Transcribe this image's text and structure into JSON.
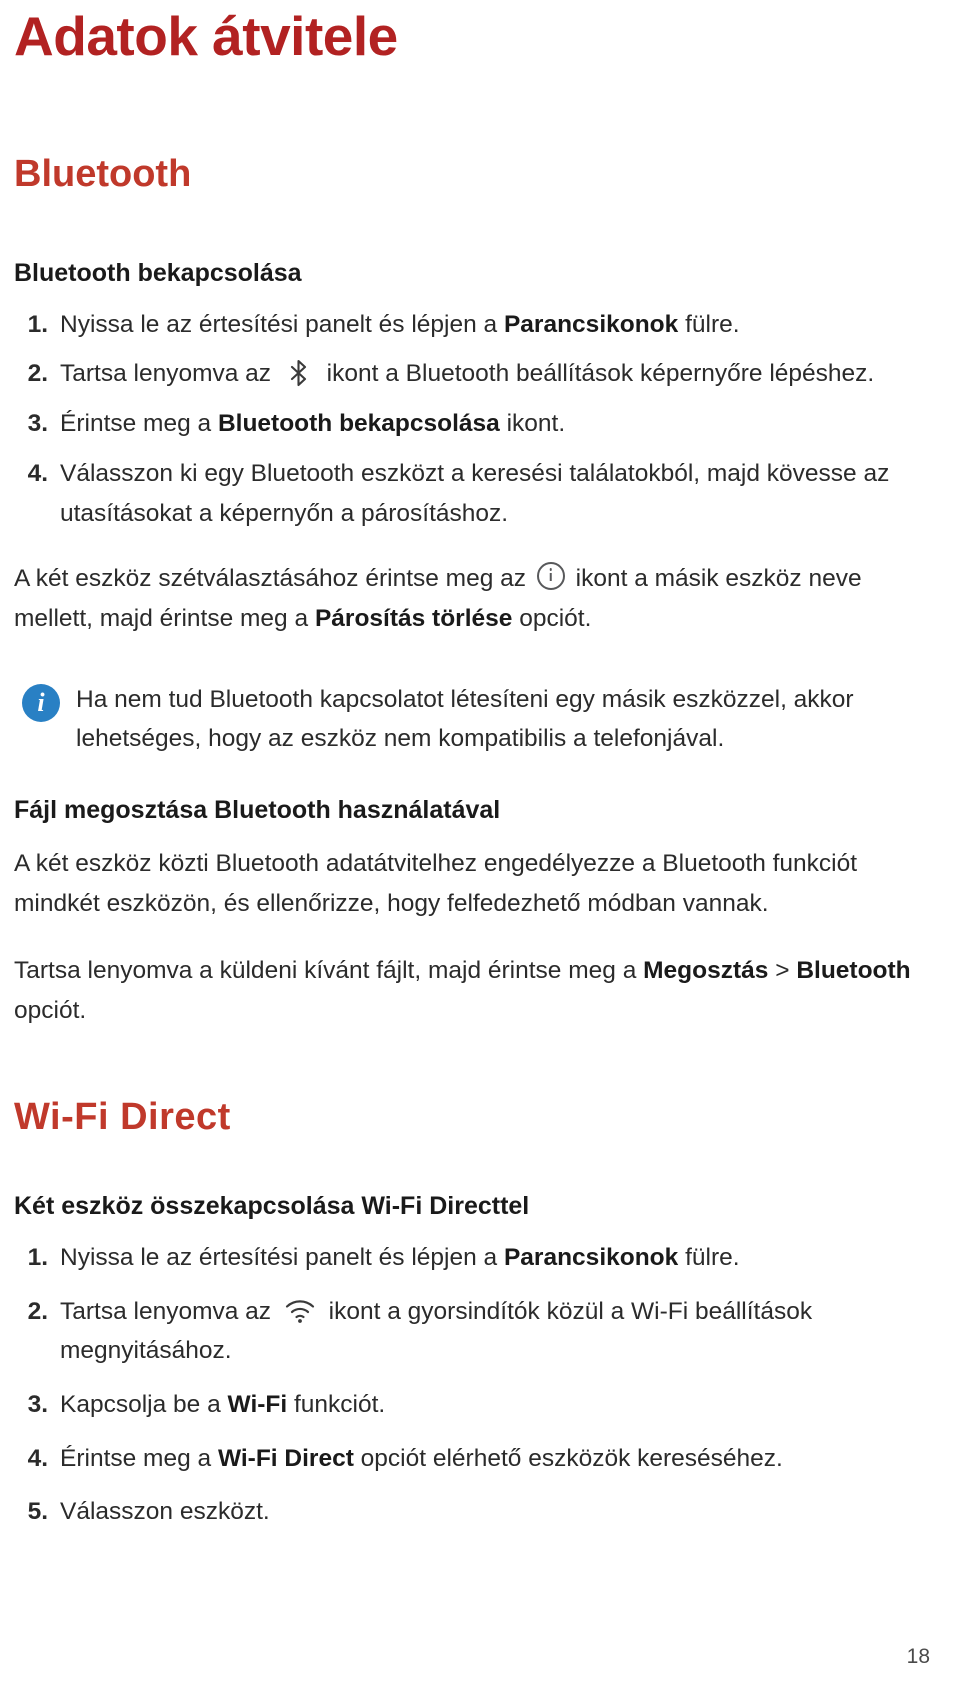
{
  "document": {
    "title": "Adatok átvitele",
    "page_number": "18"
  },
  "sections": [
    {
      "heading": "Bluetooth",
      "subsections": [
        {
          "heading": "Bluetooth bekapcsolása",
          "steps": [
            {
              "num": "1.",
              "text_before": "Nyissa le az értesítési panelt és lépjen a ",
              "bold": "Parancsikonok",
              "text_after": " fülre."
            },
            {
              "num": "2.",
              "text_before": "Tartsa lenyomva az ",
              "icon": "bluetooth-icon",
              "text_after": " ikont a Bluetooth beállítások képernyőre lépéshez."
            },
            {
              "num": "3.",
              "text_before": "Érintse meg a ",
              "bold": "Bluetooth bekapcsolása",
              "text_after": " ikont."
            },
            {
              "num": "4.",
              "text_before": "Válasszon ki egy Bluetooth eszközt a keresési találatokból, majd kövesse az utasításokat a képernyőn a párosításhoz.",
              "bold": "",
              "text_after": ""
            }
          ],
          "paragraph": {
            "part1": "A két eszköz szétválasztásához érintse meg az ",
            "icon": "info-circle-icon",
            "part2": " ikont a másik eszköz neve mellett, majd érintse meg a ",
            "bold": "Párosítás törlése",
            "part3": " opciót."
          },
          "note": {
            "icon": "info-badge-icon",
            "text": "Ha nem tud Bluetooth kapcsolatot létesíteni egy másik eszközzel, akkor lehetséges, hogy az eszköz nem kompatibilis a telefonjával."
          }
        },
        {
          "heading": "Fájl megosztása Bluetooth használatával",
          "paragraph1": "A két eszköz közti Bluetooth adatátvitelhez engedélyezze a Bluetooth funkciót mindkét eszközön, és ellenőrizze, hogy felfedezhető módban vannak.",
          "paragraph2": {
            "part1": "Tartsa lenyomva a küldeni kívánt fájlt, majd érintse meg a ",
            "bold1": "Megosztás",
            "part2": " > ",
            "bold2": "Bluetooth",
            "part3": " opciót."
          }
        }
      ]
    },
    {
      "heading": "Wi-Fi Direct",
      "subsections": [
        {
          "heading": "Két eszköz összekapcsolása Wi-Fi Directtel",
          "steps": [
            {
              "num": "1.",
              "text_before": "Nyissa le az értesítési panelt és lépjen a ",
              "bold": "Parancsikonok",
              "text_after": " fülre."
            },
            {
              "num": "2.",
              "text_before": "Tartsa lenyomva az ",
              "icon": "wifi-icon",
              "text_after": " ikont a gyorsindítók közül a Wi-Fi beállítások megnyitásához."
            },
            {
              "num": "3.",
              "text_before": "Kapcsolja be a ",
              "bold": "Wi-Fi",
              "text_after": " funkciót."
            },
            {
              "num": "4.",
              "text_before": "Érintse meg a ",
              "bold": "Wi-Fi Direct",
              "text_after": " opciót elérhető eszközök kereséséhez."
            },
            {
              "num": "5.",
              "text_before": "Válasszon eszközt.",
              "bold": "",
              "text_after": ""
            }
          ]
        }
      ]
    }
  ],
  "colors": {
    "title_red": "#b22222",
    "section_red": "#c0392b",
    "note_blue": "#2980c4",
    "body_text": "#2b2b2b"
  }
}
